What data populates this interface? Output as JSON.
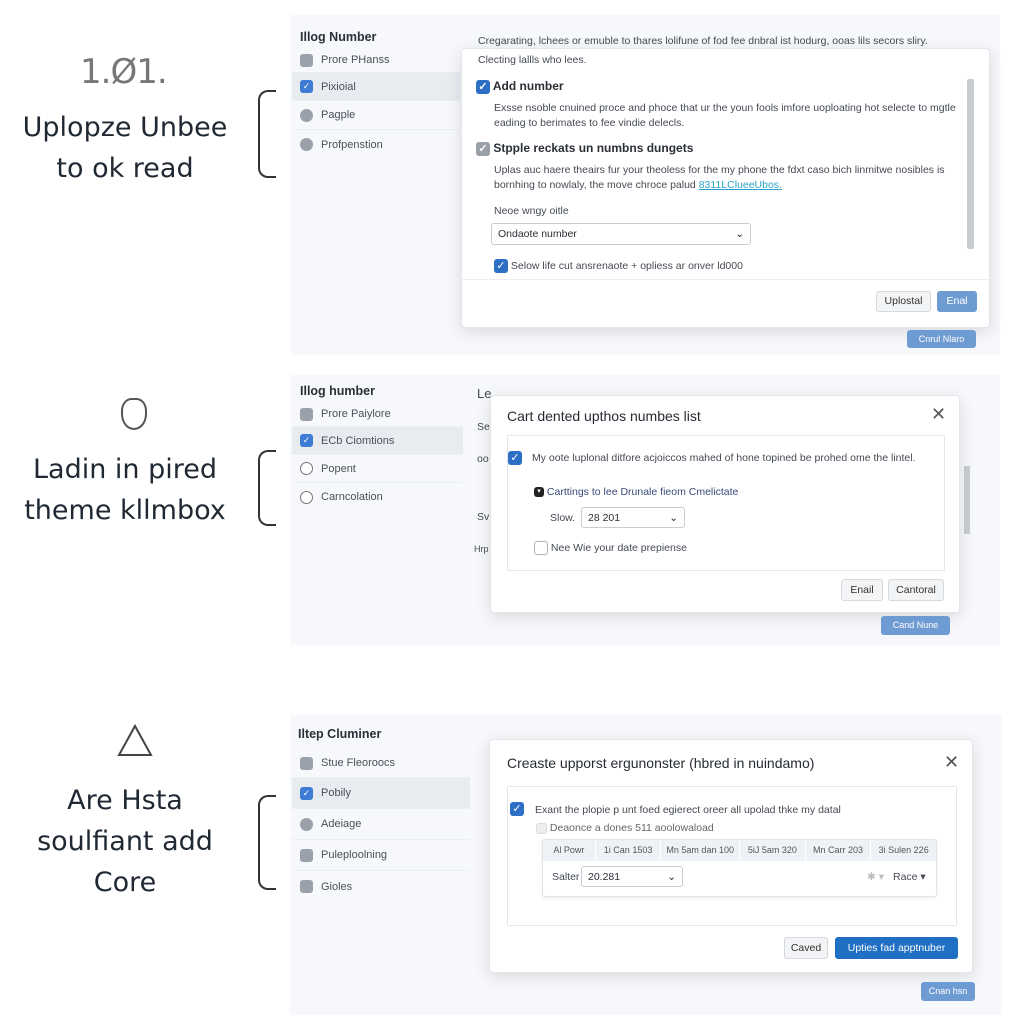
{
  "left": {
    "version": "1.Ø1.",
    "caption1": [
      "Uplopze Unbee",
      "to ok read"
    ],
    "caption2": [
      "Ladin in pired",
      "theme kllmbox"
    ],
    "caption3": [
      "Are Hsta",
      "soulfiant add",
      "Core"
    ]
  },
  "panel1": {
    "sidebar": {
      "title": "Illog Number",
      "items": [
        {
          "label": "Prore PHanss",
          "icon": "lock-icon"
        },
        {
          "label": "Pixioial",
          "icon": "checkbox-icon",
          "active": true
        },
        {
          "label": "Pagple",
          "icon": "user-icon"
        },
        {
          "label": "Profpenstion",
          "icon": "circle-icon"
        }
      ]
    },
    "header_text": "Cregarating, lchees or emuble to thares lolifune of fod fee dnbral ist hodurg, ooas lils secors sliry.",
    "dialog": {
      "intro": "Clecting lallls who lees.",
      "option1_label": "Add number",
      "option1_checked": true,
      "option1_desc": "Exsse nsoble cnuined proce and phoce that ur the youn fools imfore uoploating hot selecte to mgtle eading to berimates to fee vindie delecls.",
      "option2_label": "Stpple reckats un numbns dungets",
      "option2_desc": "Uplas auc haere theairs fur your theoless for the my phone the fdxt caso bich linmitwe nosibles is bornhing to nowlaly, the move chroce palud",
      "option2_link": "8311LClueeUbos.",
      "field_label": "Neoe wngy oitle",
      "select_value": "Ondaote number",
      "footer_check": "Selow life cut ansrenaote + opliess ar onver ld000",
      "footer_checked": true,
      "btn_secondary": "Uplostal",
      "btn_primary": "Enal"
    },
    "bottom_button": "Cnrul Nlaro"
  },
  "panel2": {
    "sidebar": {
      "title": "Illog humber",
      "items": [
        {
          "label": "Prore Paiylore",
          "icon": "lock-icon"
        },
        {
          "label": "ECb Ciomtions",
          "icon": "checkbox-icon",
          "active": true
        },
        {
          "label": "Popent",
          "icon": "circle-icon"
        },
        {
          "label": "Carncolation",
          "icon": "circle-icon"
        }
      ]
    },
    "bg_fragments": [
      "Le",
      "Se",
      "oo",
      "Sv",
      "Hrp"
    ],
    "dialog": {
      "title": "Cart dented upthos numbes list",
      "check1": "My oote luplonal ditfore acjoiccos mahed of hone topined be prohed ome the lintel.",
      "check1_checked": true,
      "sub_check": "Carttings to lee Drunale fieom Cmelictate",
      "select_label": "Slow.",
      "select_value": "28 201",
      "check2": "Nee Wie your date prepiense",
      "check2_checked": false,
      "btn1": "Enail",
      "btn2": "Cantoral"
    },
    "bottom_button": "Cand Nune"
  },
  "panel3": {
    "sidebar": {
      "title": "Iltep Cluminer",
      "items": [
        {
          "label": "Stue Fleoroocs",
          "icon": "phone-icon"
        },
        {
          "label": "Pobily",
          "icon": "checkbox-icon",
          "active": true
        },
        {
          "label": "Adeiage",
          "icon": "globe-icon"
        },
        {
          "label": "Puleploolning",
          "icon": "phone-icon"
        },
        {
          "label": "Gioles",
          "icon": "box-icon"
        }
      ]
    },
    "dialog": {
      "title": "Creaste upporst ergunonster (hbred in nuindamo)",
      "check1": "Exant the plopie p unt foed egierect oreer all upolad thke my datal",
      "check1_checked": true,
      "sub_check": "Deaonce a dones 511 aoolowaload",
      "table_headers": [
        "Al Powr",
        "1i Can 1503",
        "Mn 5am dan 100",
        "5iJ 5am 320",
        "Mn Carr 203",
        "3i Sulen 226"
      ],
      "select_label": "Salter",
      "select_value": "20.281",
      "rate_label": "Race",
      "btn_cancel": "Caved",
      "btn_primary": "Upties fad apptnuber"
    },
    "bottom_button": "Cnan hsn"
  },
  "colors": {
    "accent": "#1f6fc5",
    "soft_accent": "#6f9bd3",
    "panel_bg": "#f6f8fb"
  }
}
